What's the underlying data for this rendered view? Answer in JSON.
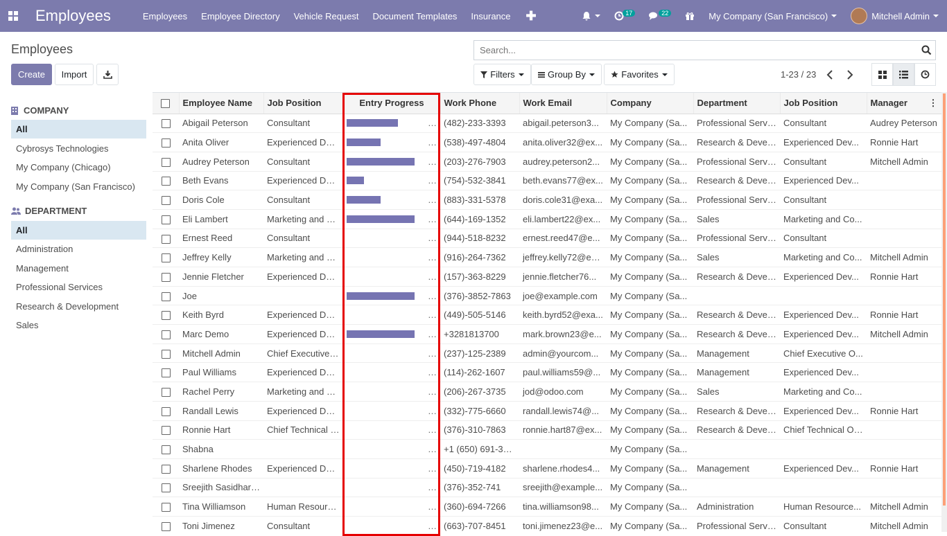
{
  "topnav": {
    "app_title": "Employees",
    "menu": [
      "Employees",
      "Employee Directory",
      "Vehicle Request",
      "Document Templates",
      "Insurance"
    ],
    "activity_count": "17",
    "message_count": "22",
    "company": "My Company (San Francisco)",
    "user": "Mitchell Admin"
  },
  "control": {
    "title": "Employees",
    "create_label": "Create",
    "import_label": "Import",
    "search_placeholder": "Search...",
    "filters_label": "Filters",
    "groupby_label": "Group By",
    "favorites_label": "Favorites",
    "pager": "1-23 / 23"
  },
  "sidebar": {
    "company_head": "COMPANY",
    "company_items": [
      "All",
      "Cybrosys Technologies",
      "My Company (Chicago)",
      "My Company (San Francisco)"
    ],
    "department_head": "DEPARTMENT",
    "department_items": [
      "All",
      "Administration",
      "Management",
      "Professional Services",
      "Research & Development",
      "Sales"
    ]
  },
  "table": {
    "columns": [
      "Employee Name",
      "Job Position",
      "Entry Progress",
      "Work Phone",
      "Work Email",
      "Company",
      "Department",
      "Job Position",
      "Manager"
    ],
    "rows": [
      {
        "name": "Abigail Peterson",
        "job": "Consultant",
        "progress": 0.75,
        "phone": "(482)-233-3393",
        "email": "abigail.peterson3...",
        "company": "My Company (Sa...",
        "dept": "Professional Servi...",
        "jobpos": "Consultant",
        "manager": "Audrey Peterson"
      },
      {
        "name": "Anita Oliver",
        "job": "Experienced Dev...",
        "progress": 0.5,
        "phone": "(538)-497-4804",
        "email": "anita.oliver32@ex...",
        "company": "My Company (Sa...",
        "dept": "Research & Devel...",
        "jobpos": "Experienced Dev...",
        "manager": "Ronnie Hart"
      },
      {
        "name": "Audrey Peterson",
        "job": "Consultant",
        "progress": 1.0,
        "phone": "(203)-276-7903",
        "email": "audrey.peterson2...",
        "company": "My Company (Sa...",
        "dept": "Professional Servi...",
        "jobpos": "Consultant",
        "manager": "Mitchell Admin"
      },
      {
        "name": "Beth Evans",
        "job": "Experienced Dev...",
        "progress": 0.25,
        "phone": "(754)-532-3841",
        "email": "beth.evans77@ex...",
        "company": "My Company (Sa...",
        "dept": "Research & Devel...",
        "jobpos": "Experienced Dev...",
        "manager": ""
      },
      {
        "name": "Doris Cole",
        "job": "Consultant",
        "progress": 0.5,
        "phone": "(883)-331-5378",
        "email": "doris.cole31@exa...",
        "company": "My Company (Sa...",
        "dept": "Professional Servi...",
        "jobpos": "Consultant",
        "manager": ""
      },
      {
        "name": "Eli Lambert",
        "job": "Marketing and Co...",
        "progress": 1.0,
        "phone": "(644)-169-1352",
        "email": "eli.lambert22@ex...",
        "company": "My Company (Sa...",
        "dept": "Sales",
        "jobpos": "Marketing and Co...",
        "manager": ""
      },
      {
        "name": "Ernest Reed",
        "job": "Consultant",
        "progress": 0,
        "phone": "(944)-518-8232",
        "email": "ernest.reed47@e...",
        "company": "My Company (Sa...",
        "dept": "Professional Servi...",
        "jobpos": "Consultant",
        "manager": ""
      },
      {
        "name": "Jeffrey Kelly",
        "job": "Marketing and Co...",
        "progress": 0,
        "phone": "(916)-264-7362",
        "email": "jeffrey.kelly72@ex...",
        "company": "My Company (Sa...",
        "dept": "Sales",
        "jobpos": "Marketing and Co...",
        "manager": "Mitchell Admin"
      },
      {
        "name": "Jennie Fletcher",
        "job": "Experienced Dev...",
        "progress": 0,
        "phone": "(157)-363-8229",
        "email": "jennie.fletcher76...",
        "company": "My Company (Sa...",
        "dept": "Research & Devel...",
        "jobpos": "Experienced Dev...",
        "manager": "Ronnie Hart"
      },
      {
        "name": "Joe",
        "job": "",
        "progress": 1.0,
        "phone": "(376)-3852-7863",
        "email": "joe@example.com",
        "company": "My Company (Sa...",
        "dept": "",
        "jobpos": "",
        "manager": ""
      },
      {
        "name": "Keith Byrd",
        "job": "Experienced Dev...",
        "progress": 0,
        "phone": "(449)-505-5146",
        "email": "keith.byrd52@exa...",
        "company": "My Company (Sa...",
        "dept": "Research & Devel...",
        "jobpos": "Experienced Dev...",
        "manager": "Ronnie Hart"
      },
      {
        "name": "Marc Demo",
        "job": "Experienced Dev...",
        "progress": 1.0,
        "phone": "+3281813700",
        "email": "mark.brown23@e...",
        "company": "My Company (Sa...",
        "dept": "Research & Devel...",
        "jobpos": "Experienced Dev...",
        "manager": "Mitchell Admin"
      },
      {
        "name": "Mitchell Admin",
        "job": "Chief Executive O...",
        "progress": 0,
        "phone": "(237)-125-2389",
        "email": "admin@yourcom...",
        "company": "My Company (Sa...",
        "dept": "Management",
        "jobpos": "Chief Executive O...",
        "manager": ""
      },
      {
        "name": "Paul Williams",
        "job": "Experienced Dev...",
        "progress": 0,
        "phone": "(114)-262-1607",
        "email": "paul.williams59@...",
        "company": "My Company (Sa...",
        "dept": "Management",
        "jobpos": "Experienced Dev...",
        "manager": ""
      },
      {
        "name": "Rachel Perry",
        "job": "Marketing and Co...",
        "progress": 0,
        "phone": "(206)-267-3735",
        "email": "jod@odoo.com",
        "company": "My Company (Sa...",
        "dept": "Sales",
        "jobpos": "Marketing and Co...",
        "manager": ""
      },
      {
        "name": "Randall Lewis",
        "job": "Experienced Dev...",
        "progress": 0,
        "phone": "(332)-775-6660",
        "email": "randall.lewis74@...",
        "company": "My Company (Sa...",
        "dept": "Research & Devel...",
        "jobpos": "Experienced Dev...",
        "manager": "Ronnie Hart"
      },
      {
        "name": "Ronnie Hart",
        "job": "Chief Technical Of...",
        "progress": 0,
        "phone": "(376)-310-7863",
        "email": "ronnie.hart87@ex...",
        "company": "My Company (Sa...",
        "dept": "Research & Devel...",
        "jobpos": "Chief Technical Of...",
        "manager": ""
      },
      {
        "name": "Shabna",
        "job": "",
        "progress": 0,
        "phone": "+1 (650) 691-3277",
        "email": "",
        "company": "My Company (Sa...",
        "dept": "",
        "jobpos": "",
        "manager": ""
      },
      {
        "name": "Sharlene Rhodes",
        "job": "Experienced Dev...",
        "progress": 0,
        "phone": "(450)-719-4182",
        "email": "sharlene.rhodes4...",
        "company": "My Company (Sa...",
        "dept": "Management",
        "jobpos": "Experienced Dev...",
        "manager": "Ronnie Hart"
      },
      {
        "name": "Sreejith Sasidharan",
        "job": "",
        "progress": 0,
        "phone": "(376)-352-741",
        "email": "sreejith@example...",
        "company": "My Company (Sa...",
        "dept": "",
        "jobpos": "",
        "manager": ""
      },
      {
        "name": "Tina Williamson",
        "job": "Human Resource...",
        "progress": 0,
        "phone": "(360)-694-7266",
        "email": "tina.williamson98...",
        "company": "My Company (Sa...",
        "dept": "Administration",
        "jobpos": "Human Resource...",
        "manager": "Mitchell Admin"
      },
      {
        "name": "Toni Jimenez",
        "job": "Consultant",
        "progress": 0,
        "phone": "(663)-707-8451",
        "email": "toni.jimenez23@e...",
        "company": "My Company (Sa...",
        "dept": "Professional Servi...",
        "jobpos": "Consultant",
        "manager": "Mitchell Admin"
      }
    ]
  },
  "colors": {
    "brand": "#7c7bad",
    "progress": "#7674b2",
    "highlight": "#e50000"
  }
}
